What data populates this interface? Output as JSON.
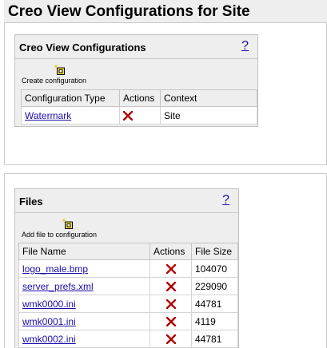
{
  "page": {
    "title": "Creo View Configurations for Site"
  },
  "configurations": {
    "title": "Creo View Configurations",
    "help": "?",
    "action_label": "Create configuration",
    "columns": [
      "Configuration Type",
      "Actions",
      "Context"
    ],
    "rows": [
      {
        "type": "Watermark",
        "context": "Site"
      }
    ]
  },
  "files": {
    "title": "Files",
    "help": "?",
    "action_label": "Add file to configuration",
    "columns": [
      "File Name",
      "Actions",
      "File Size"
    ],
    "rows": [
      {
        "name": "logo_male.bmp",
        "size": "104070"
      },
      {
        "name": "server_prefs.xml",
        "size": "229090"
      },
      {
        "name": "wmk0000.ini",
        "size": "44781"
      },
      {
        "name": "wmk0001.ini",
        "size": "4119"
      },
      {
        "name": "wmk0002.ini",
        "size": "44781"
      }
    ]
  },
  "colors": {
    "delete": "#b00000",
    "link": "#1a0dab",
    "panel_bg": "#eeeeee"
  },
  "icons": {
    "create": "add-sparkle-icon",
    "delete": "delete-x-icon"
  }
}
